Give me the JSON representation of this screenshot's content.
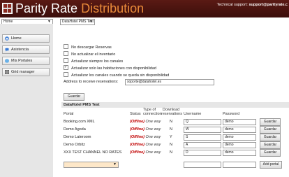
{
  "header": {
    "brand": "Parity",
    "brand_accent": "Rate",
    "brand_sub": "Distribution",
    "support_label": "Technical support:",
    "support_email": "support@parityrate.c"
  },
  "topbar": {
    "home_select": "Home",
    "hotel_select": "DataHotel PMS Test"
  },
  "sidebar": {
    "items": [
      {
        "label": "Home",
        "icon": "home-icon"
      },
      {
        "label": "Asistencia",
        "icon": "chat-icon"
      },
      {
        "label": "Mis Portales",
        "icon": "globe-icon"
      },
      {
        "label": "Grid manager",
        "icon": "grid-icon"
      }
    ]
  },
  "options": [
    {
      "label": "No descargar Reservas",
      "checked": false
    },
    {
      "label": "No actualizar el inventario",
      "checked": false
    },
    {
      "label": "Actualizar siempre los canales",
      "checked": false
    },
    {
      "label": "Actualizar solo las habitaciones con disponibilidad",
      "checked": true
    },
    {
      "label": "Actualizar los canales cuando se queda sin disponibilidad",
      "checked": false
    }
  ],
  "address": {
    "label": "Address to receive reservations:",
    "value": "soporte@datahotel.es"
  },
  "save_button": "Guardar",
  "section_title": "DataHotel PMS Test",
  "table": {
    "headers": {
      "portal": "Portal",
      "status": "Status",
      "type": "Type of connection",
      "download": "Download reservations",
      "username": "Username",
      "password": "Password"
    },
    "rows": [
      {
        "portal": "Booking.com XML",
        "status": "(Offline)",
        "type": "One way",
        "download": "N",
        "username": "Q",
        "password": "demo",
        "button": "Guardar"
      },
      {
        "portal": "Demo Agoda",
        "status": "(Offline)",
        "type": "One way",
        "download": "N",
        "username": "W",
        "password": "demo",
        "button": "Guardar"
      },
      {
        "portal": "Demo Lateroom",
        "status": "(Offline)",
        "type": "One way",
        "download": "Y",
        "username": "S",
        "password": "demo",
        "button": "Guardar"
      },
      {
        "portal": "Demo Orbitz",
        "status": "(Offline)",
        "type": "One way",
        "download": "N",
        "username": "A",
        "password": "demo",
        "button": "Guardar"
      },
      {
        "portal": "XXX TEST CHANNEL NO RATES",
        "status": "(Offline)",
        "type": "One way",
        "download": "N",
        "username": "D",
        "password": "demo",
        "button": "Guardar"
      }
    ],
    "add_portal_button": "Add portal"
  },
  "colors": {
    "header_bg": "#4a1410",
    "accent": "#e98a3a",
    "offline": "#c00000"
  }
}
